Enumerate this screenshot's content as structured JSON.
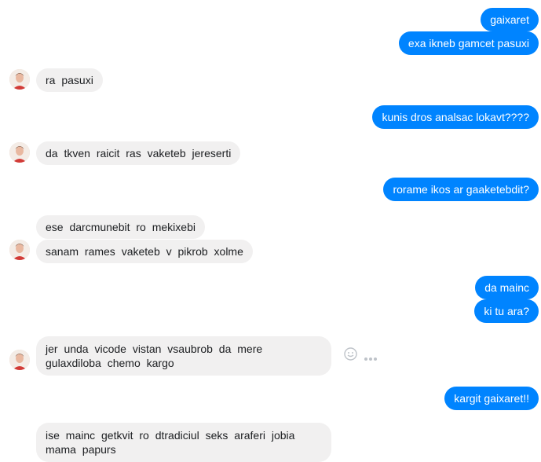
{
  "conversation": {
    "messages": [
      {
        "side": "out",
        "text": "gaixaret"
      },
      {
        "side": "out",
        "text": "exa ikneb gamcet pasuxi"
      },
      {
        "side": "in",
        "text": "ra  pasuxi"
      },
      {
        "side": "out",
        "text": "kunis dros analsac lokavt????"
      },
      {
        "side": "in",
        "text": "da  tkven  raicit  ras  vaketeb  jereserti"
      },
      {
        "side": "out",
        "text": "rorame ikos ar gaaketebdit?"
      },
      {
        "side": "in",
        "text": "ese  darcmunebit  ro  mekixebi"
      },
      {
        "side": "in",
        "text": "sanam  rames  vaketeb  v  pikrob  xolme"
      },
      {
        "side": "out",
        "text": "da mainc"
      },
      {
        "side": "out",
        "text": "ki tu ara?"
      },
      {
        "side": "in",
        "text": "jer  unda  vicode  vistan  vsaubrob  da  mere  gulaxdiloba  chemo  kargo"
      },
      {
        "side": "out",
        "text": "kargit gaixaret!!"
      },
      {
        "side": "in",
        "text": "ise  mainc   getkvit   ro  dtradiciul  seks  araferi  jobia  mama  papurs"
      }
    ]
  },
  "icons": {
    "emoji": "smiley-icon",
    "more": "more-icon"
  },
  "colors": {
    "outgoing_bubble": "#0084ff",
    "incoming_bubble": "#f1f0f0"
  }
}
